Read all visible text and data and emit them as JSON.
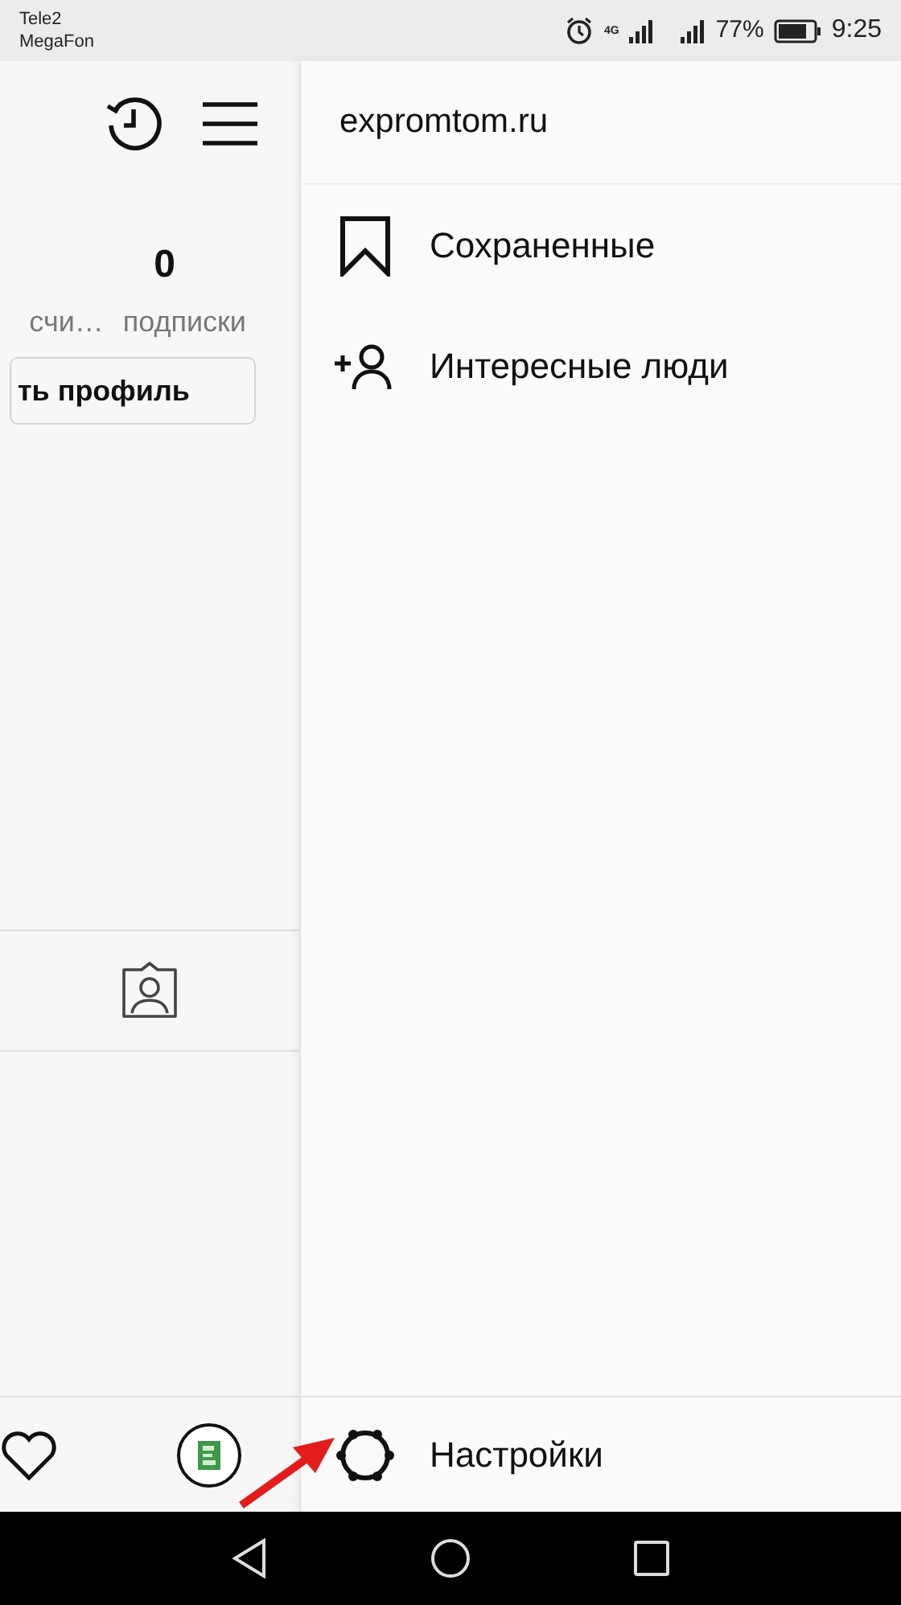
{
  "status_bar": {
    "carriers": [
      "Tele2",
      "MegaFon"
    ],
    "network": "4G",
    "battery": "77%",
    "time": "9:25"
  },
  "profile": {
    "count": "0",
    "stat_labels": [
      "счи…",
      "подписки"
    ],
    "edit_button": "ть профиль"
  },
  "drawer": {
    "title": "expromtom.ru",
    "items": [
      {
        "kind": "bookmark",
        "label": "Сохраненные"
      },
      {
        "kind": "add-person",
        "label": "Интересные люди"
      }
    ],
    "footer_item": {
      "kind": "settings",
      "label": "Настройки"
    }
  }
}
